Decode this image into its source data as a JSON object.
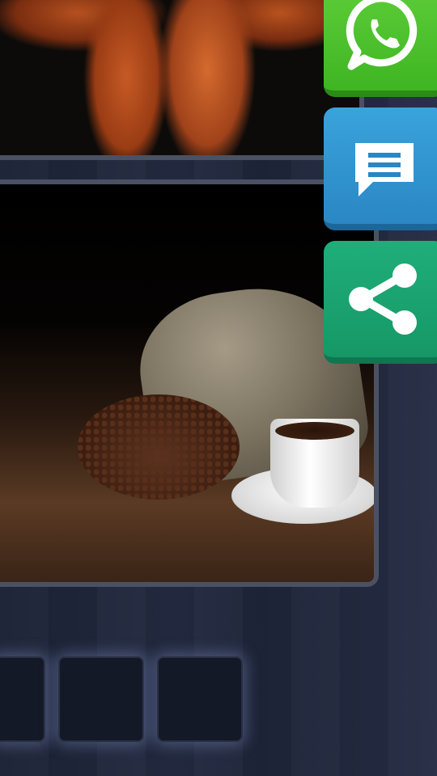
{
  "puzzle": {
    "pictures": [
      {
        "description_icon": "arms-photo"
      },
      {
        "description_icon": "coffee-photo"
      }
    ],
    "answer_slots": [
      "",
      "",
      ""
    ]
  },
  "side_buttons": [
    {
      "icon": "whatsapp-icon",
      "color": "#3fb523"
    },
    {
      "icon": "message-icon",
      "color": "#2a87c3"
    },
    {
      "icon": "share-icon",
      "color": "#169866"
    }
  ]
}
